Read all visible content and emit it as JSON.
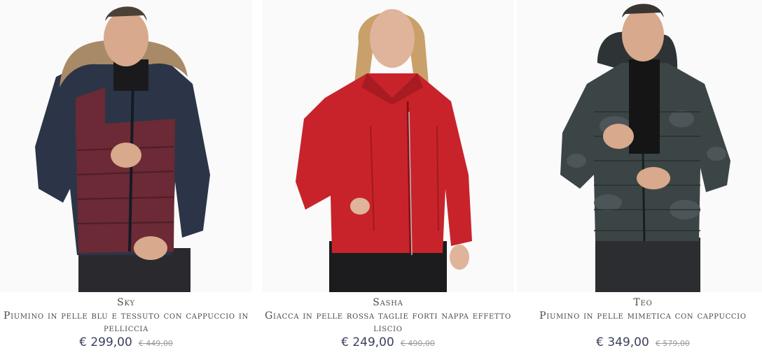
{
  "products": [
    {
      "name": "Sky",
      "description": "Piumino in pelle blu e tessuto con cappuccio in pelliccia",
      "price": "€ 299,00",
      "old_price": "€ 449,00"
    },
    {
      "name": "Sasha",
      "description": "Giacca in pelle rossa taglie forti nappa effetto liscio",
      "price": "€ 249,00",
      "old_price": "€ 490,00"
    },
    {
      "name": "Teo",
      "description": "Piumino in pelle mimetica con cappuccio",
      "price": "€ 349,00",
      "old_price": "€ 579,00"
    }
  ],
  "colors": {
    "jacket_navy": "#2b3547",
    "jacket_burgundy": "#6b2a35",
    "fur": "#a88a66",
    "jacket_red": "#c8232b",
    "jacket_camo": "#3c4546",
    "price_text": "#3a3f5c"
  }
}
